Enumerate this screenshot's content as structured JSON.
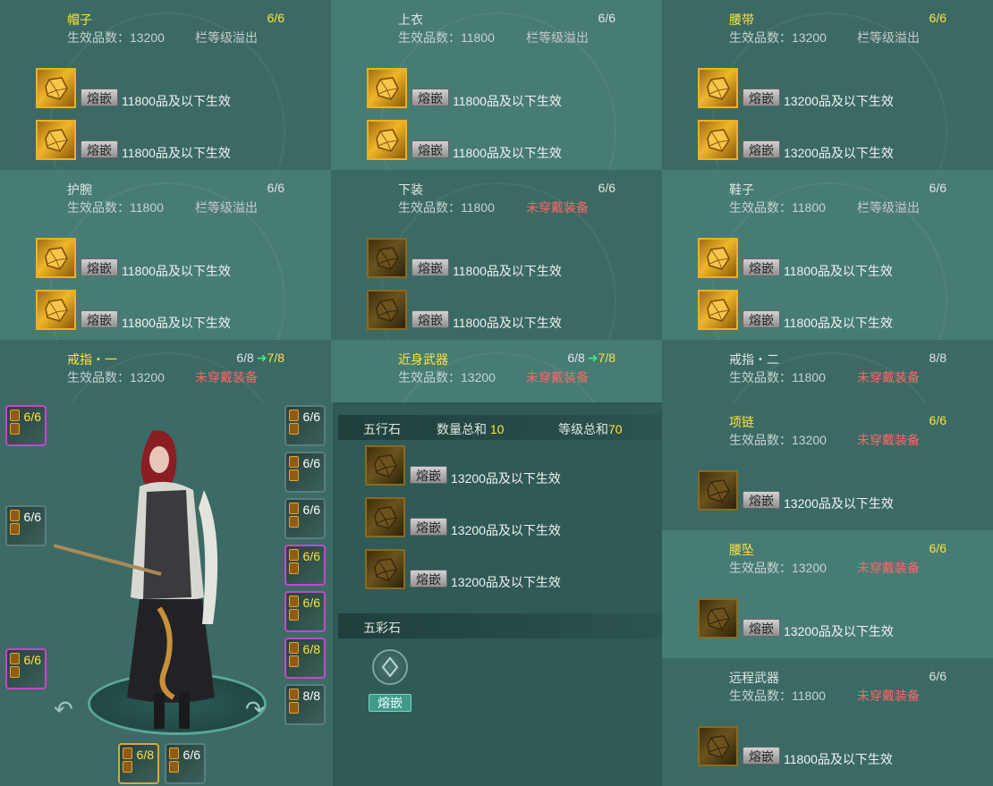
{
  "panels": [
    {
      "title": "帽子",
      "title_yellow": true,
      "count": "6/6",
      "count_yellow": true,
      "count_plus": "",
      "effective": "生效品数：13200",
      "status": "栏等级溢出",
      "status_red": false,
      "slots": [
        {
          "label": "11800品及以下生效",
          "dim": false
        },
        {
          "label": "11800品及以下生效",
          "dim": false
        }
      ]
    },
    {
      "title": "上衣",
      "title_yellow": false,
      "count": "6/6",
      "count_yellow": false,
      "count_plus": "",
      "effective": "生效品数：11800",
      "status": "栏等级溢出",
      "status_red": false,
      "slots": [
        {
          "label": "11800品及以下生效",
          "dim": false
        },
        {
          "label": "11800品及以下生效",
          "dim": false
        }
      ]
    },
    {
      "title": "腰带",
      "title_yellow": true,
      "count": "6/6",
      "count_yellow": true,
      "count_plus": "",
      "effective": "生效品数：13200",
      "status": "栏等级溢出",
      "status_red": false,
      "slots": [
        {
          "label": "13200品及以下生效",
          "dim": false
        },
        {
          "label": "13200品及以下生效",
          "dim": false
        }
      ]
    },
    {
      "title": "护腕",
      "title_yellow": false,
      "count": "6/6",
      "count_yellow": false,
      "count_plus": "",
      "effective": "生效品数：11800",
      "status": "栏等级溢出",
      "status_red": false,
      "slots": [
        {
          "label": "11800品及以下生效",
          "dim": false
        },
        {
          "label": "11800品及以下生效",
          "dim": false
        }
      ]
    },
    {
      "title": "下装",
      "title_yellow": false,
      "count": "6/6",
      "count_yellow": false,
      "count_plus": "",
      "effective": "生效品数：11800",
      "status": "未穿戴装备",
      "status_red": true,
      "slots": [
        {
          "label": "11800品及以下生效",
          "dim": true
        },
        {
          "label": "11800品及以下生效",
          "dim": true
        }
      ]
    },
    {
      "title": "鞋子",
      "title_yellow": false,
      "count": "6/6",
      "count_yellow": false,
      "count_plus": "",
      "effective": "生效品数：11800",
      "status": "栏等级溢出",
      "status_red": false,
      "slots": [
        {
          "label": "11800品及以下生效",
          "dim": false
        },
        {
          "label": "11800品及以下生效",
          "dim": false
        }
      ]
    },
    {
      "title": "戒指・一",
      "title_yellow": true,
      "count": "6/8",
      "count_yellow": false,
      "count_plus": "7/8",
      "effective": "生效品数：13200",
      "status": "未穿戴装备",
      "status_red": true,
      "slots": []
    },
    {
      "title": "近身武器",
      "title_yellow": true,
      "count": "6/8",
      "count_yellow": false,
      "count_plus": "7/8",
      "effective": "生效品数：13200",
      "status": "未穿戴装备",
      "status_red": true,
      "slots": []
    },
    {
      "title": "戒指・二",
      "title_yellow": false,
      "count": "8/8",
      "count_yellow": false,
      "count_plus": "",
      "effective": "生效品数：11800",
      "status": "未穿戴装备",
      "status_red": true,
      "slots": []
    }
  ],
  "right_panels": [
    {
      "title": "项链",
      "title_yellow": true,
      "count": "6/6",
      "count_yellow": true,
      "effective": "生效品数：13200",
      "status": "未穿戴装备",
      "slot_label": "13200品及以下生效"
    },
    {
      "title": "腰坠",
      "title_yellow": true,
      "count": "6/6",
      "count_yellow": true,
      "effective": "生效品数：13200",
      "status": "未穿戴装备",
      "slot_label": "13200品及以下生效"
    },
    {
      "title": "远程武器",
      "title_yellow": false,
      "count": "6/6",
      "count_yellow": false,
      "effective": "生效品数：11800",
      "status": "未穿戴装备",
      "slot_label": "11800品及以下生效"
    }
  ],
  "inlay_label": "熔嵌",
  "wuxing": {
    "title": "五行石",
    "qty_label": "数量总和",
    "qty_value": "10",
    "lvl_label": "等级总和",
    "lvl_value": "70",
    "slots": [
      "13200品及以下生效",
      "13200品及以下生效",
      "13200品及以下生效"
    ]
  },
  "wucai": {
    "title": "五彩石",
    "button": "熔嵌"
  },
  "left_slots": [
    {
      "value": "6/6",
      "yellow": true,
      "style": "purple"
    },
    {
      "value": "6/6",
      "yellow": false,
      "style": "plain"
    },
    {
      "value": "6/6",
      "yellow": true,
      "style": "purple"
    }
  ],
  "right_slots": [
    {
      "value": "6/6",
      "yellow": false,
      "style": "plain"
    },
    {
      "value": "6/6",
      "yellow": false,
      "style": "plain"
    },
    {
      "value": "6/6",
      "yellow": false,
      "style": "plain"
    },
    {
      "value": "6/6",
      "yellow": true,
      "style": "purple"
    },
    {
      "value": "6/6",
      "yellow": true,
      "style": "purple"
    },
    {
      "value": "6/8",
      "yellow": true,
      "style": "purple"
    },
    {
      "value": "8/8",
      "yellow": false,
      "style": "plain"
    }
  ],
  "bottom_slots": [
    {
      "value": "6/8",
      "yellow": true,
      "style": "gold"
    },
    {
      "value": "6/6",
      "yellow": false,
      "style": "plain"
    }
  ],
  "colors": {
    "yellow": "#ffe23d",
    "red": "#ff6565",
    "green": "#3ee97b"
  }
}
